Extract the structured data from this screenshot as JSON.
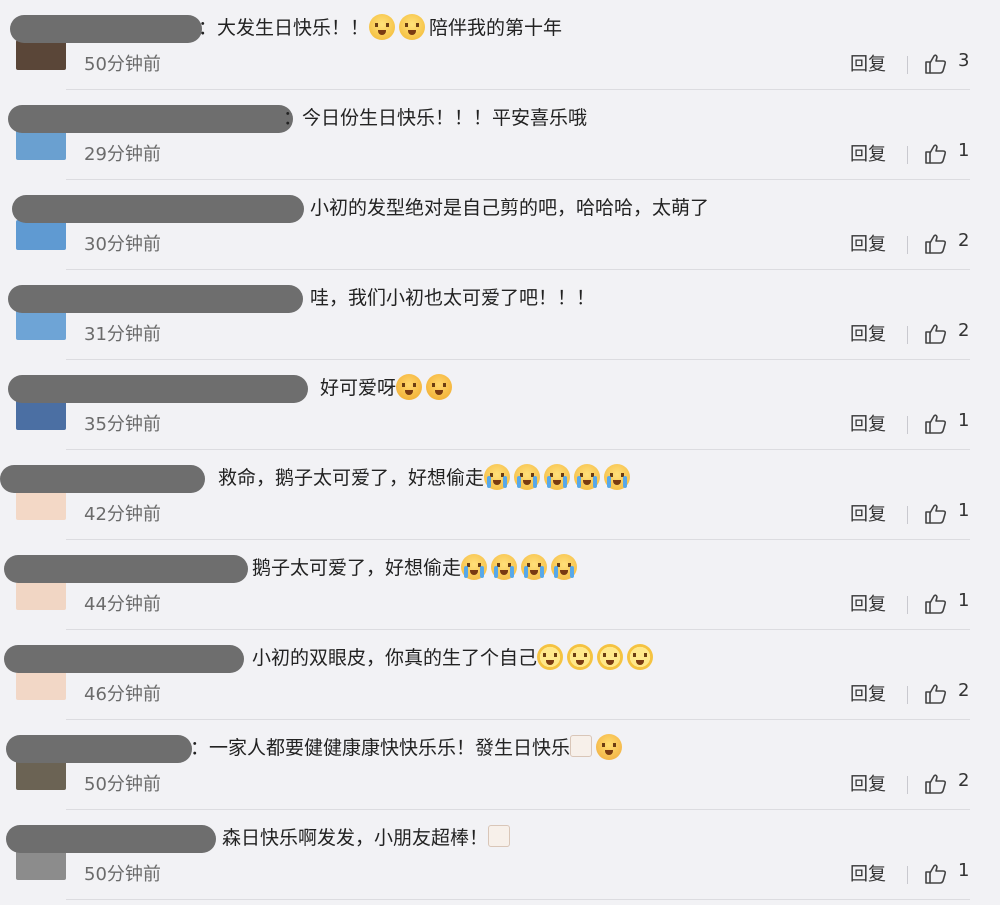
{
  "ui": {
    "reply_label": "回复",
    "colors": {
      "background": "#f2f2f5",
      "name_mask": "#6e6e6e",
      "time_text": "#6b6b6b",
      "divider": "#dcdce0"
    },
    "icons": {
      "like": "thumbs-up-icon"
    }
  },
  "comments": [
    {
      "text": "：大发生日快乐！！",
      "emoji": [
        "kiss",
        "kiss"
      ],
      "text_after": "陪伴我的第十年",
      "time": "50分钟前",
      "likes": "3"
    },
    {
      "text": "：今日份生日快乐！！！平安喜乐哦",
      "emoji": [],
      "text_after": "",
      "time": "29分钟前",
      "likes": "1"
    },
    {
      "text": "小初的发型绝对是自己剪的吧，哈哈哈，太萌了",
      "emoji": [],
      "text_after": "",
      "time": "30分钟前",
      "likes": "2"
    },
    {
      "text": "哇，我们小初也太可爱了吧！！！",
      "emoji": [],
      "text_after": "",
      "time": "31分钟前",
      "likes": "2"
    },
    {
      "text": "好可爱呀",
      "emoji": [
        "shock",
        "shock"
      ],
      "text_after": "",
      "time": "35分钟前",
      "likes": "1"
    },
    {
      "text": "救命，鹅子太可爱了，好想偷走",
      "emoji": [
        "cry",
        "cry",
        "cry",
        "cry",
        "cry"
      ],
      "text_after": "",
      "time": "42分钟前",
      "likes": "1"
    },
    {
      "text": "鹅子太可爱了，好想偷走",
      "emoji": [
        "cry",
        "cry",
        "cry",
        "cry"
      ],
      "text_after": "",
      "time": "44分钟前",
      "likes": "1"
    },
    {
      "text": "小初的双眼皮，你真的生了个自己",
      "emoji": [
        "sun",
        "sun",
        "sun",
        "sun"
      ],
      "text_after": "",
      "time": "46分钟前",
      "likes": "2"
    },
    {
      "text": "：一家人都要健健康康快快乐乐！發生日快乐",
      "emoji": [
        "cake",
        "tear"
      ],
      "text_after": "",
      "time": "50分钟前",
      "likes": "2"
    },
    {
      "text": "森日快乐啊发发，小朋友超棒！",
      "emoji": [
        "cake"
      ],
      "text_after": "",
      "time": "50分钟前",
      "likes": "1"
    }
  ]
}
